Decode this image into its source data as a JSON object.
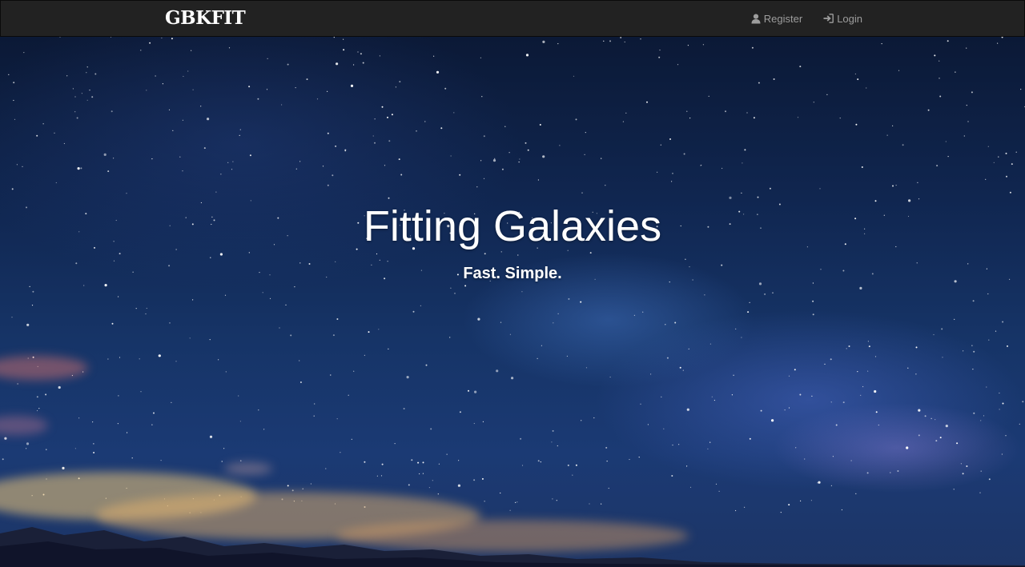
{
  "navbar": {
    "brand": "GBKFIT",
    "links": [
      {
        "label": "Register",
        "icon": "user-icon"
      },
      {
        "label": "Login",
        "icon": "login-icon"
      }
    ]
  },
  "hero": {
    "title": "Fitting Galaxies",
    "subtitle": "Fast. Simple.",
    "background": "starry-night-sky-photo"
  },
  "colors": {
    "navbar_bg": "#222222",
    "nav_link": "#9d9d9d",
    "brand": "#ffffff",
    "hero_text": "#ffffff"
  }
}
